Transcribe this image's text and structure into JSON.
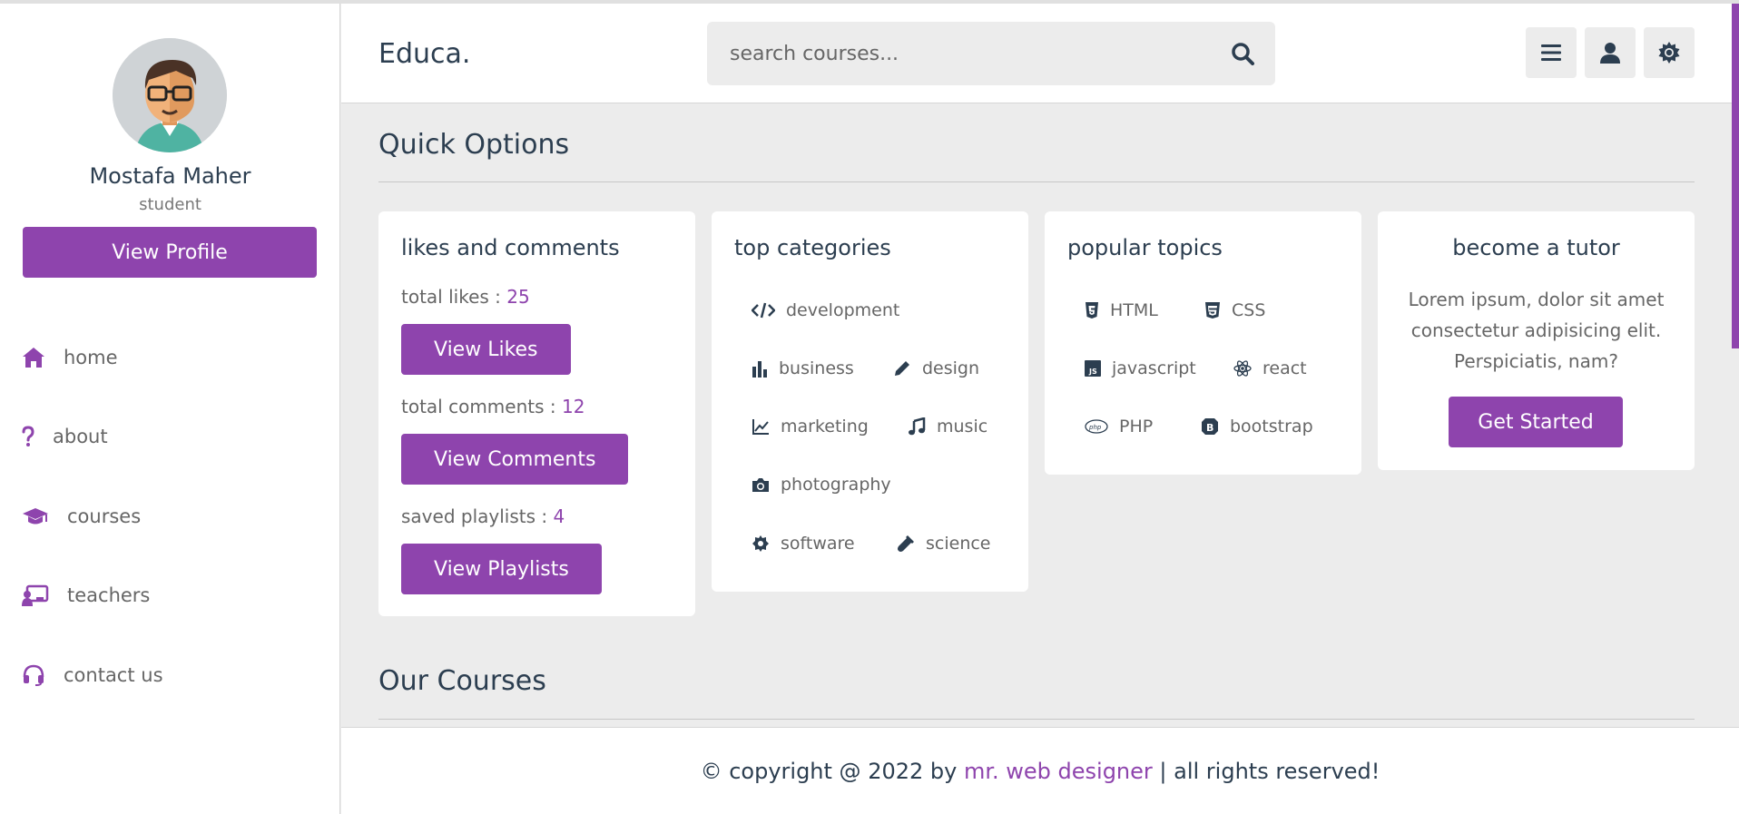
{
  "profile": {
    "name": "Mostafa Maher",
    "role": "student",
    "view_profile_label": "View Profile"
  },
  "nav": {
    "items": [
      {
        "label": "home",
        "icon": "home-icon"
      },
      {
        "label": "about",
        "icon": "question-icon"
      },
      {
        "label": "courses",
        "icon": "graduation-cap-icon"
      },
      {
        "label": "teachers",
        "icon": "chalkboard-teacher-icon"
      },
      {
        "label": "contact us",
        "icon": "headset-icon"
      }
    ]
  },
  "header": {
    "logo": "Educa.",
    "search_placeholder": "search courses..."
  },
  "sections": {
    "quick_options": "Quick Options",
    "our_courses": "Our Courses"
  },
  "likes_card": {
    "title": "likes and comments",
    "likes_label": "total likes : ",
    "likes_value": "25",
    "view_likes": "View Likes",
    "comments_label": "total comments : ",
    "comments_value": "12",
    "view_comments": "View Comments",
    "playlists_label": "saved playlists : ",
    "playlists_value": "4",
    "view_playlists": "View Playlists"
  },
  "categories_card": {
    "title": "top categories",
    "items": [
      {
        "label": "development",
        "icon": "code-icon"
      },
      {
        "label": "business",
        "icon": "chart-bar-icon"
      },
      {
        "label": "design",
        "icon": "pen-icon"
      },
      {
        "label": "marketing",
        "icon": "chart-line-icon"
      },
      {
        "label": "music",
        "icon": "music-icon"
      },
      {
        "label": "photography",
        "icon": "camera-icon"
      },
      {
        "label": "software",
        "icon": "cog-icon"
      },
      {
        "label": "science",
        "icon": "vial-icon"
      }
    ]
  },
  "topics_card": {
    "title": "popular topics",
    "items": [
      {
        "label": "HTML",
        "icon": "html5-icon"
      },
      {
        "label": "CSS",
        "icon": "css3-icon"
      },
      {
        "label": "javascript",
        "icon": "js-icon"
      },
      {
        "label": "react",
        "icon": "react-icon"
      },
      {
        "label": "PHP",
        "icon": "php-icon"
      },
      {
        "label": "bootstrap",
        "icon": "bootstrap-icon"
      }
    ]
  },
  "tutor_card": {
    "title": "become a tutor",
    "text": "Lorem ipsum, dolor sit amet consectetur adipisicing elit. Perspiciatis, nam?",
    "button": "Get Started"
  },
  "footer": {
    "prefix": "© copyright @ 2022 by ",
    "author": "mr. web designer",
    "suffix": " | all rights reserved!"
  },
  "colors": {
    "accent": "#8e44ad",
    "text": "#2c3e50",
    "background": "#ececec"
  }
}
